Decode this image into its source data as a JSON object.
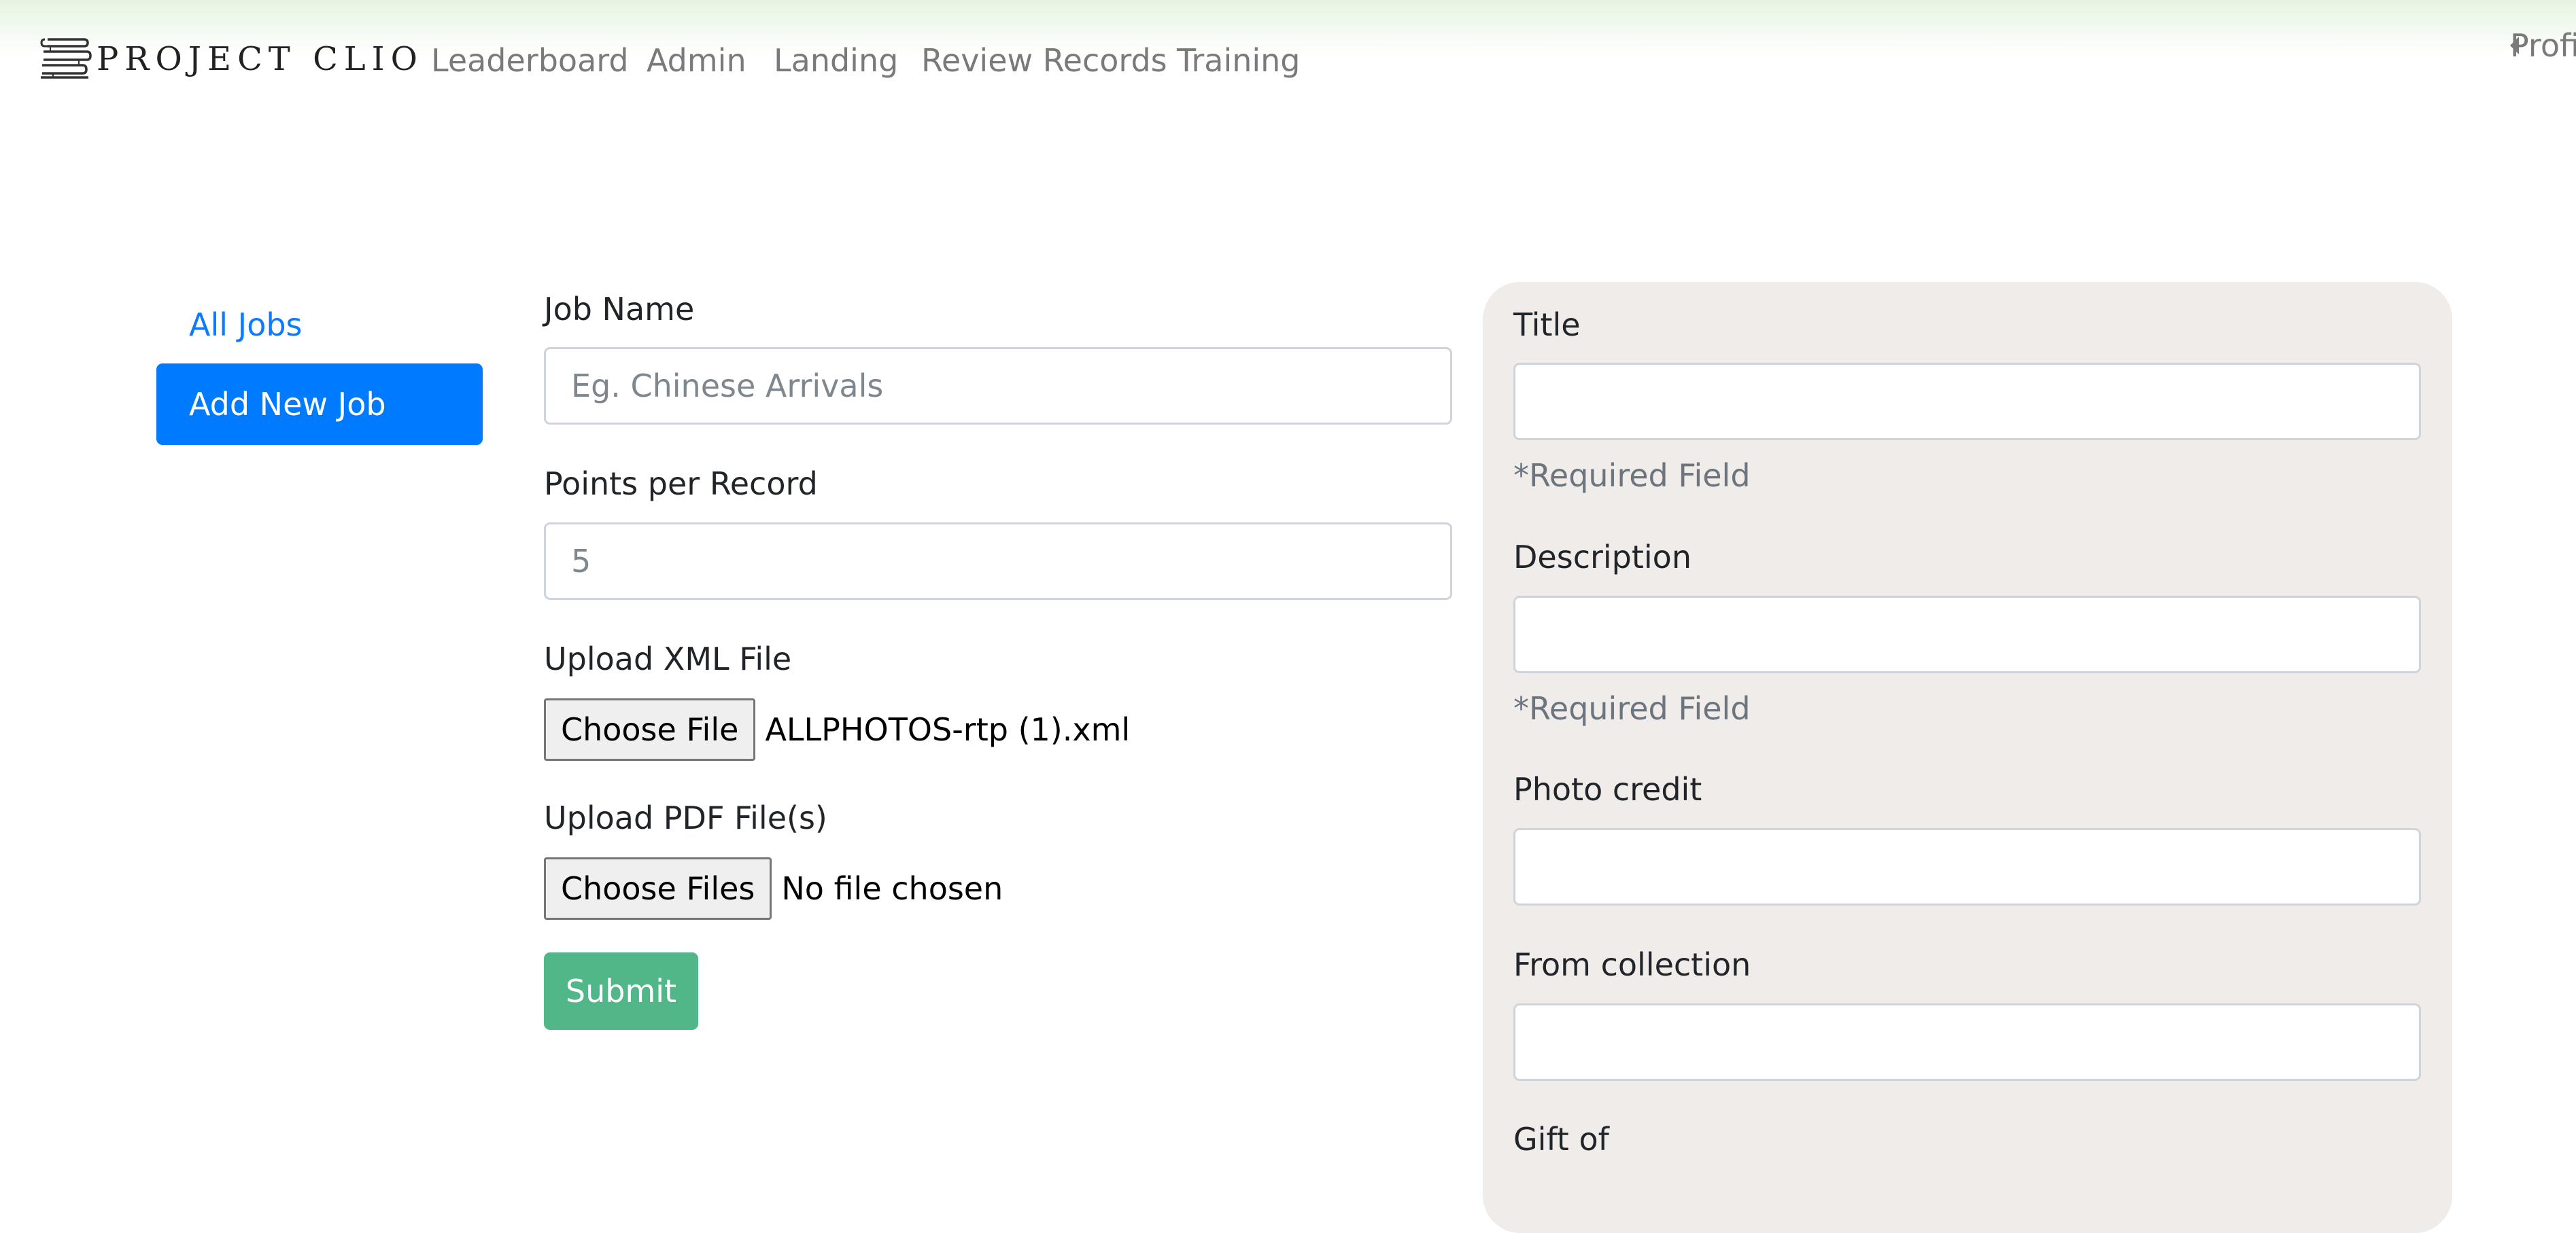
{
  "navbar": {
    "brand": "PROJECT CLIO",
    "brand_icon": "stacked-books-icon",
    "links": [
      "Leaderboard",
      "Admin",
      "Landing",
      "Review Records",
      "Training"
    ],
    "profile": "Profile",
    "profile_icon": "caret-left-icon"
  },
  "sidebar": {
    "items": [
      {
        "label": "All Jobs",
        "active": false
      },
      {
        "label": "Add New Job",
        "active": true
      }
    ]
  },
  "form": {
    "job_name": {
      "label": "Job Name",
      "placeholder": "Eg. Chinese Arrivals",
      "value": ""
    },
    "points": {
      "label": "Points per Record",
      "placeholder": "5",
      "value": ""
    },
    "xml_upload": {
      "label": "Upload XML File",
      "button": "Choose File",
      "file": "ALLPHOTOS-rtp (1).xml"
    },
    "pdf_upload": {
      "label": "Upload PDF File(s)",
      "button": "Choose Files",
      "file": "No file chosen"
    },
    "submit": "Submit"
  },
  "fields_panel": {
    "fields": [
      {
        "label": "Title",
        "value": "",
        "helper": "*Required Field"
      },
      {
        "label": "Description",
        "value": "",
        "helper": "*Required Field"
      },
      {
        "label": "Photo credit",
        "value": "",
        "helper": ""
      },
      {
        "label": "From collection",
        "value": "",
        "helper": ""
      },
      {
        "label": "Gift of",
        "value": "",
        "helper": ""
      }
    ]
  },
  "colors": {
    "primary": "#007bff",
    "link": "#0d7bff",
    "success": "#52b788",
    "panel_bg": "#f0ecea",
    "nav_gradient": "#e6f4e2",
    "muted": "#6c757d"
  }
}
